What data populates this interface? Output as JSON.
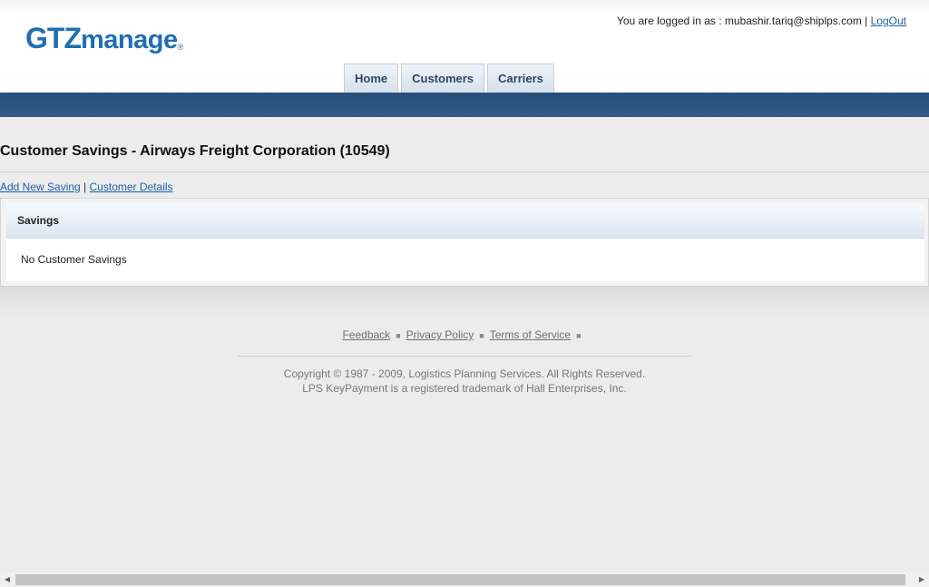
{
  "logo": {
    "primary": "GTZ",
    "secondary": "manage",
    "mark": "®"
  },
  "user": {
    "logged_in_prefix": "You are logged in as : ",
    "email": "mubashir.tariq@shiplps.com",
    "divider": " | ",
    "logout_label": "LogOut"
  },
  "tabs": [
    {
      "label": "Home"
    },
    {
      "label": "Customers"
    },
    {
      "label": "Carriers"
    }
  ],
  "page": {
    "title": "Customer Savings - Airways Freight Corporation (10549)",
    "links": {
      "add_new": "Add New Saving",
      "divider": " | ",
      "details": "Customer Details"
    }
  },
  "panel": {
    "title": "Savings",
    "empty_message": "No Customer Savings"
  },
  "footer": {
    "links": [
      {
        "label": "Feedback"
      },
      {
        "label": "Privacy Policy"
      },
      {
        "label": "Terms of Service"
      }
    ],
    "separator": "■",
    "copyright_line1": "Copyright © 1987 - 2009, Logistics Planning Services. All Rights Reserved.",
    "copyright_line2": "LPS KeyPayment is a registered trademark of Hall Enterprises, Inc."
  },
  "scrollbar": {
    "left_arrow": "◀",
    "right_arrow": "▶"
  }
}
